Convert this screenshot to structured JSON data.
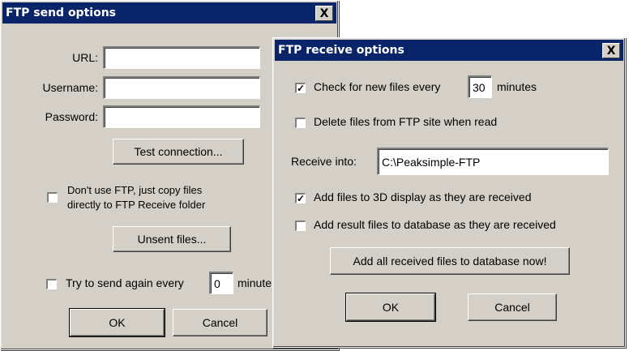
{
  "send_dialog": {
    "title": "FTP send options",
    "close_label": "X",
    "url_label": "URL:",
    "url_value": "",
    "username_label": "Username:",
    "username_value": "",
    "password_label": "Password:",
    "password_value": "",
    "test_connection_label": "Test connection...",
    "dont_use_ftp": {
      "checked": false,
      "line1": "Don't use FTP, just copy files",
      "line2": "directly to FTP Receive folder"
    },
    "unsent_files_label": "Unsent files...",
    "retry": {
      "checked": false,
      "label": "Try to send again every",
      "value": "0",
      "unit": "minute"
    },
    "ok_label": "OK",
    "cancel_label": "Cancel"
  },
  "receive_dialog": {
    "title": "FTP receive options",
    "close_label": "X",
    "check_new": {
      "checked": true,
      "label": "Check for new files every",
      "value": "30",
      "unit": "minutes"
    },
    "delete_files": {
      "checked": false,
      "label": "Delete files from FTP site when read"
    },
    "receive_into_label": "Receive into:",
    "receive_into_value": "C:\\Peaksimple-FTP",
    "add_3d": {
      "checked": true,
      "label": "Add files to 3D display as they are received"
    },
    "add_db": {
      "checked": false,
      "label": "Add result files to database as they are received"
    },
    "add_all_label": "Add all received files to database now!",
    "ok_label": "OK",
    "cancel_label": "Cancel"
  },
  "checkmark_glyph": "✓"
}
